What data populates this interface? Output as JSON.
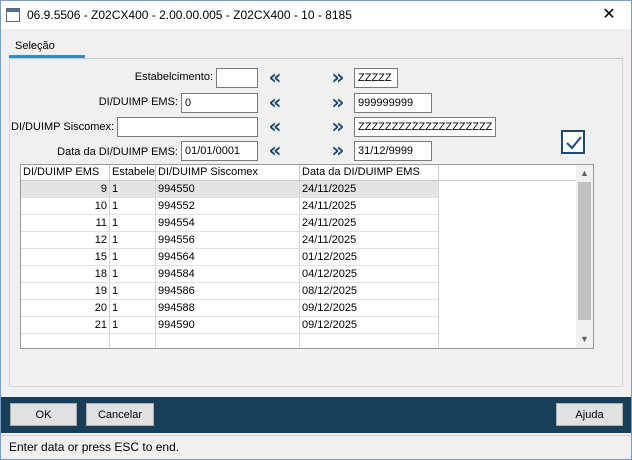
{
  "window": {
    "title": "06.9.5506 - Z02CX400 - 2.00.00.005 - Z02CX400 - 10 - 8185",
    "close_glyph": "✕"
  },
  "tabs": [
    {
      "label": "Seleção",
      "active": true
    }
  ],
  "filters": [
    {
      "label": "Estabelcimento:",
      "from": "",
      "to": "ZZZZZ"
    },
    {
      "label": "DI/DUIMP EMS:",
      "from": "0",
      "to": "999999999"
    },
    {
      "label": "DI/DUIMP Siscomex:",
      "from": "",
      "to": "ZZZZZZZZZZZZZZZZZZZZ"
    },
    {
      "label": "Data da DI/DUIMP EMS:",
      "from": "01/01/0001",
      "to": "31/12/9999"
    }
  ],
  "range_glyphs": {
    "left": "«",
    "right": "»"
  },
  "icons": {
    "confirm": "check-icon",
    "scroll_up": "chevron-up-icon",
    "scroll_down": "chevron-down-icon"
  },
  "table": {
    "columns": [
      "DI/DUIMP EMS",
      "Estabelec",
      "DI/DUIMP Siscomex",
      "Data da DI/DUIMP EMS"
    ],
    "rows": [
      [
        "9",
        "1",
        "994550",
        "24/11/2025"
      ],
      [
        "10",
        "1",
        "994552",
        "24/11/2025"
      ],
      [
        "11",
        "1",
        "994554",
        "24/11/2025"
      ],
      [
        "12",
        "1",
        "994556",
        "24/11/2025"
      ],
      [
        "15",
        "1",
        "994564",
        "01/12/2025"
      ],
      [
        "18",
        "1",
        "994584",
        "04/12/2025"
      ],
      [
        "19",
        "1",
        "994586",
        "08/12/2025"
      ],
      [
        "20",
        "1",
        "994588",
        "09/12/2025"
      ],
      [
        "21",
        "1",
        "994590",
        "09/12/2025"
      ]
    ],
    "selected_row": 0
  },
  "buttons": {
    "ok": "OK",
    "cancel": "Cancelar",
    "help": "Ajuda"
  },
  "status": "Enter data or press ESC to end.",
  "colors": {
    "button_bar": "#173f58",
    "accent": "#1e4a78",
    "tab_underline": "#3a8ac5"
  }
}
